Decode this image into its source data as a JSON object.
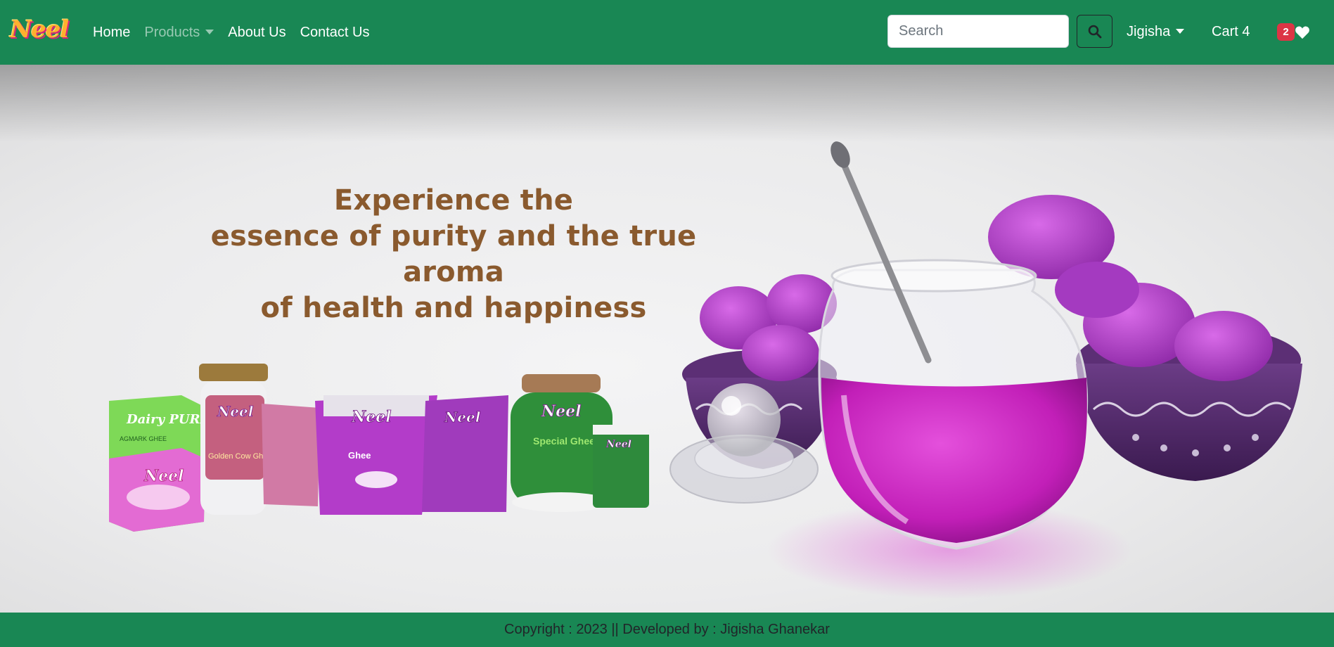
{
  "brand": {
    "logo_text": "Neel"
  },
  "nav": {
    "home": "Home",
    "products": "Products",
    "about": "About Us",
    "contact": "Contact Us"
  },
  "search": {
    "placeholder": "Search",
    "value": ""
  },
  "user": {
    "name": "Jigisha"
  },
  "cart": {
    "label": "Cart 4"
  },
  "wishlist": {
    "count": "2"
  },
  "hero": {
    "headline_line1": "Experience the",
    "headline_line2": "essence of purity and the true aroma",
    "headline_line3": "of health and happiness",
    "headline_color": "#8a5a2e"
  },
  "products": {
    "box_top": "Dairy PURE",
    "box_sub": "AGMARK GHEE",
    "jar1_name": "Golden Cow Ghee",
    "pouch_name": "Ghee",
    "jar2_name": "Special Ghee",
    "brand": "Neel"
  },
  "footer": {
    "text": "Copyright : 2023 || Developed by : Jigisha Ghanekar"
  },
  "colors": {
    "navbar": "#198754",
    "footer": "#198754",
    "badge": "#dc3545",
    "accent_purple": "#c026d3"
  },
  "icons": {
    "search": "search-icon",
    "heart": "heart-icon",
    "caret": "caret-down-icon"
  }
}
